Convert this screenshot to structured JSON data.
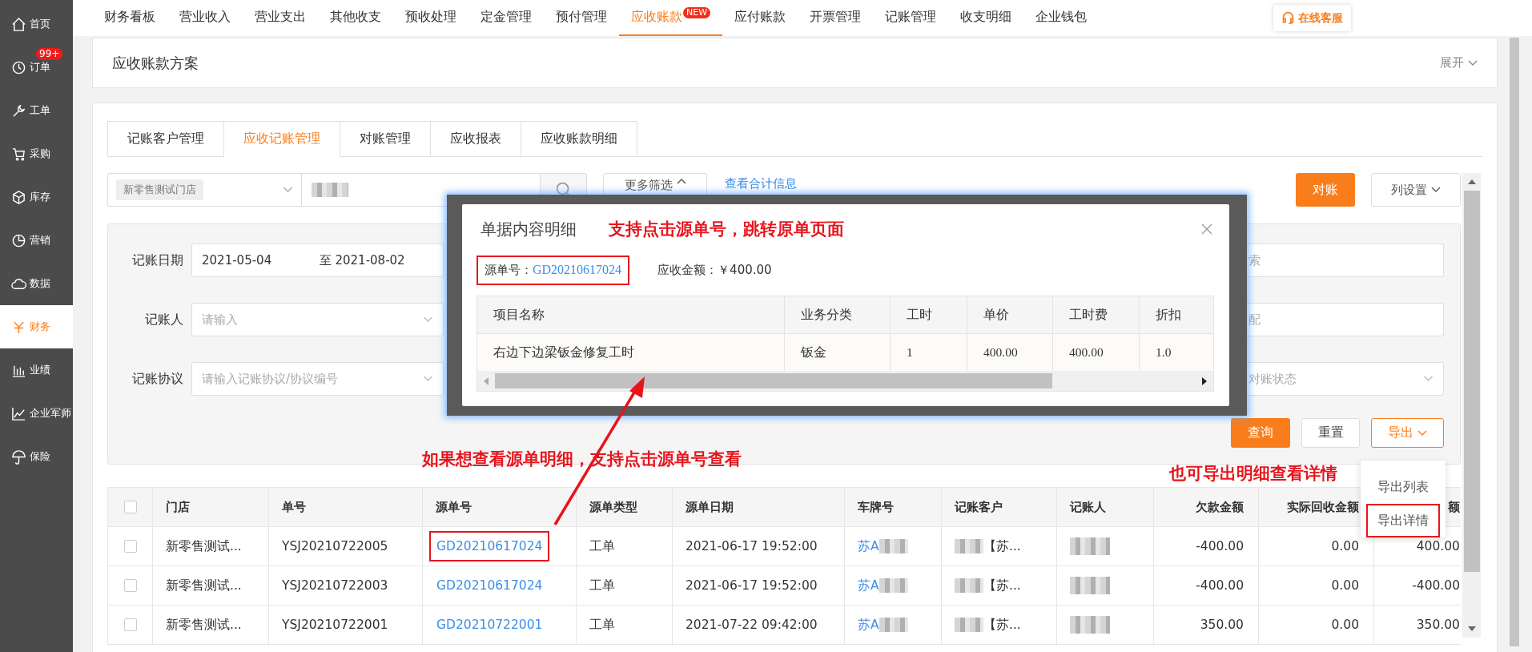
{
  "sidebar": {
    "items": [
      {
        "label": "首页",
        "selected": false
      },
      {
        "label": "订单",
        "selected": false,
        "badge": "99+"
      },
      {
        "label": "工单",
        "selected": false
      },
      {
        "label": "采购",
        "selected": false
      },
      {
        "label": "库存",
        "selected": false
      },
      {
        "label": "营销",
        "selected": false
      },
      {
        "label": "数据",
        "selected": false
      },
      {
        "label": "财务",
        "selected": true
      },
      {
        "label": "业绩",
        "selected": false
      },
      {
        "label": "企业军师",
        "selected": false
      },
      {
        "label": "保险",
        "selected": false
      }
    ]
  },
  "top_nav": {
    "items": [
      {
        "label": "财务看板",
        "selected": false
      },
      {
        "label": "营业收入",
        "selected": false
      },
      {
        "label": "营业支出",
        "selected": false
      },
      {
        "label": "其他收支",
        "selected": false
      },
      {
        "label": "预收处理",
        "selected": false
      },
      {
        "label": "定金管理",
        "selected": false
      },
      {
        "label": "预付管理",
        "selected": false
      },
      {
        "label": "应收账款",
        "selected": true,
        "badge": "NEW"
      },
      {
        "label": "应付账款",
        "selected": false
      },
      {
        "label": "开票管理",
        "selected": false
      },
      {
        "label": "记账管理",
        "selected": false
      },
      {
        "label": "收支明细",
        "selected": false
      },
      {
        "label": "企业钱包",
        "selected": false
      }
    ],
    "service_button": "在线客服"
  },
  "scheme_panel": {
    "title": "应收账款方案",
    "toggle": "展开"
  },
  "tabs": [
    {
      "label": "记账客户管理",
      "selected": false
    },
    {
      "label": "应收记账管理",
      "selected": true
    },
    {
      "label": "对账管理",
      "selected": false
    },
    {
      "label": "应收报表",
      "selected": false
    },
    {
      "label": "应收账款明细",
      "selected": false
    }
  ],
  "search_bar": {
    "store_tag": "新零售测试门店",
    "more_filters": "更多筛选",
    "summary_link": "查看合计信息",
    "reconcile_button": "对账",
    "columns_button": "列设置"
  },
  "filters": [
    {
      "label": "记账日期",
      "kind": "date_range",
      "start": "2021-05-04",
      "end": "至 2021-08-02"
    },
    {
      "label": "记账人",
      "kind": "select",
      "placeholder": "请输入"
    },
    {
      "label": "记账协议",
      "kind": "select",
      "placeholder": "请输入记账协议/协议编号"
    }
  ],
  "filters_right": [
    {
      "kind": "input",
      "placeholder": "索"
    },
    {
      "kind": "input",
      "placeholder": "配"
    },
    {
      "kind": "select",
      "placeholder": "对账状态"
    }
  ],
  "filter_buttons": {
    "query": "查询",
    "reset": "重置",
    "export": "导出"
  },
  "export_menu": [
    {
      "label": "导出列表",
      "annotated": false
    },
    {
      "label": "导出详情",
      "annotated": true
    }
  ],
  "table": {
    "header_checked": false,
    "columns": [
      "门店",
      "单号",
      "源单号",
      "源单类型",
      "源单日期",
      "车牌号",
      "记账客户",
      "记账人",
      "欠款金额",
      "实际回收金额",
      "额"
    ],
    "rows": [
      {
        "checked": false,
        "store": "新零售测试...",
        "number": "YSJ20210722005",
        "source_number": "GD20210617024",
        "annotated": true,
        "source_type": "工单",
        "source_date": "2021-06-17 19:52:00",
        "plate": "苏A",
        "customer": "【苏...",
        "debt": "-400.00",
        "recovered": "0.00",
        "column_12": "400.00"
      },
      {
        "checked": false,
        "store": "新零售测试...",
        "number": "YSJ20210722003",
        "source_number": "GD20210617024",
        "annotated": false,
        "source_type": "工单",
        "source_date": "2021-06-17 19:52:00",
        "plate": "苏A",
        "customer": "【苏...",
        "debt": "-400.00",
        "recovered": "0.00",
        "column_12": "-400.00"
      },
      {
        "checked": false,
        "store": "新零售测试...",
        "number": "YSJ20210722001",
        "source_number": "GD20210722001",
        "annotated": false,
        "source_type": "工单",
        "source_date": "2021-07-22 09:42:00",
        "plate": "苏A",
        "customer": "【苏...",
        "debt": "350.00",
        "recovered": "0.00",
        "column_12": "350.00"
      }
    ]
  },
  "dialog": {
    "title": "单据内容明细",
    "note": "支持点击源单号，跳转原单页面",
    "source_label": "源单号：",
    "source_number": "GD20210617024",
    "source_annotated": true,
    "amount": "应收金额：￥400.00",
    "columns": [
      "项目名称",
      "业务分类",
      "工时",
      "单价",
      "工时费",
      "折扣"
    ],
    "rows": [
      [
        "右边下边梁钣金修复工时",
        "钣金",
        "1",
        "400.00",
        "400.00",
        "1.0"
      ]
    ]
  },
  "annotations": {
    "table_note": "如果想查看源单明细，支持点击源单号查看",
    "export_note": "也可导出明细查看详情"
  }
}
